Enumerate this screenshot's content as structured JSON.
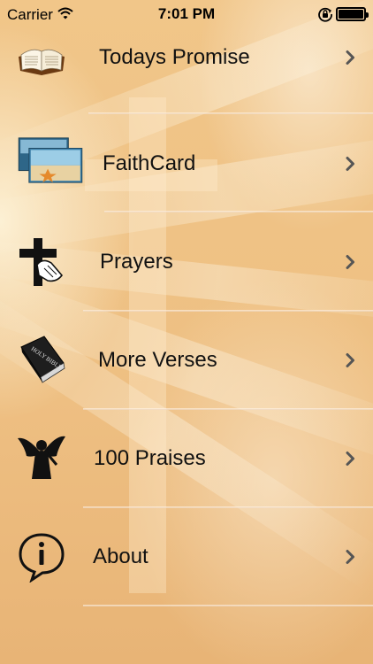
{
  "status_bar": {
    "carrier": "Carrier",
    "time": "7:01 PM",
    "wifi_icon": "wifi-icon",
    "orientation_icon": "orientation-lock-icon",
    "battery_icon": "battery-icon"
  },
  "menu": {
    "items": [
      {
        "label": "Todays Promise",
        "icon": "open-bible-icon"
      },
      {
        "label": "FaithCard",
        "icon": "faith-card-icon"
      },
      {
        "label": "Prayers",
        "icon": "cross-praying-hands-icon"
      },
      {
        "label": "More Verses",
        "icon": "holy-bible-book-icon"
      },
      {
        "label": "100 Praises",
        "icon": "angel-icon"
      },
      {
        "label": "About",
        "icon": "info-speech-bubble-icon"
      }
    ],
    "chevron_icon": "chevron-right-icon"
  },
  "colors": {
    "background": "#efc285",
    "text": "#111111",
    "chevron": "#555555"
  }
}
